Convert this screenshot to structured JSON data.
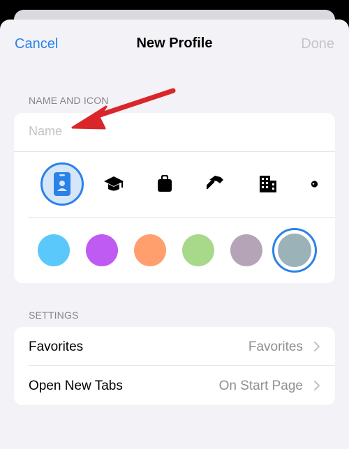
{
  "nav": {
    "cancel_label": "Cancel",
    "title": "New Profile",
    "done_label": "Done"
  },
  "name_section": {
    "header": "NAME AND ICON",
    "name_placeholder": "Name",
    "name_value": "",
    "icons": [
      "person-badge-icon",
      "graduation-cap-icon",
      "briefcase-icon",
      "hammer-icon",
      "building-icon",
      "globe-icon"
    ],
    "selected_icon": "person-badge-icon",
    "colors": [
      "#5ac8fa",
      "#bf5af2",
      "#ff9f6d",
      "#a8d88a",
      "#b5a4b8",
      "#9bb2b8"
    ],
    "selected_color": "#9bb2b8"
  },
  "settings_section": {
    "header": "SETTINGS",
    "rows": [
      {
        "label": "Favorites",
        "value": "Favorites"
      },
      {
        "label": "Open New Tabs",
        "value": "On Start Page"
      }
    ]
  },
  "colors": {
    "accent": "#2a82e8",
    "annotation_arrow": "#d9262b"
  }
}
